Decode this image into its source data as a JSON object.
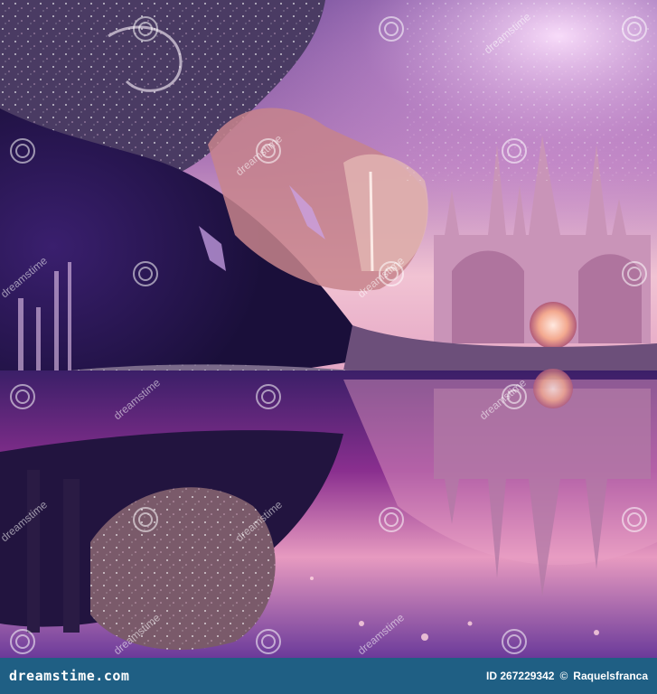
{
  "footer": {
    "brand": "dreamstime.com",
    "id_text": "ID 267229342",
    "separator": "©",
    "author": "Raquelsfranca"
  },
  "watermark": {
    "text": "dreamstime"
  },
  "colors": {
    "footer_bg": "#1f5f84",
    "sky_pink": "#f4c7d9",
    "deep_purple": "#2b1a5a",
    "magenta": "#c13b9d",
    "castle": "#d9a4c6"
  }
}
